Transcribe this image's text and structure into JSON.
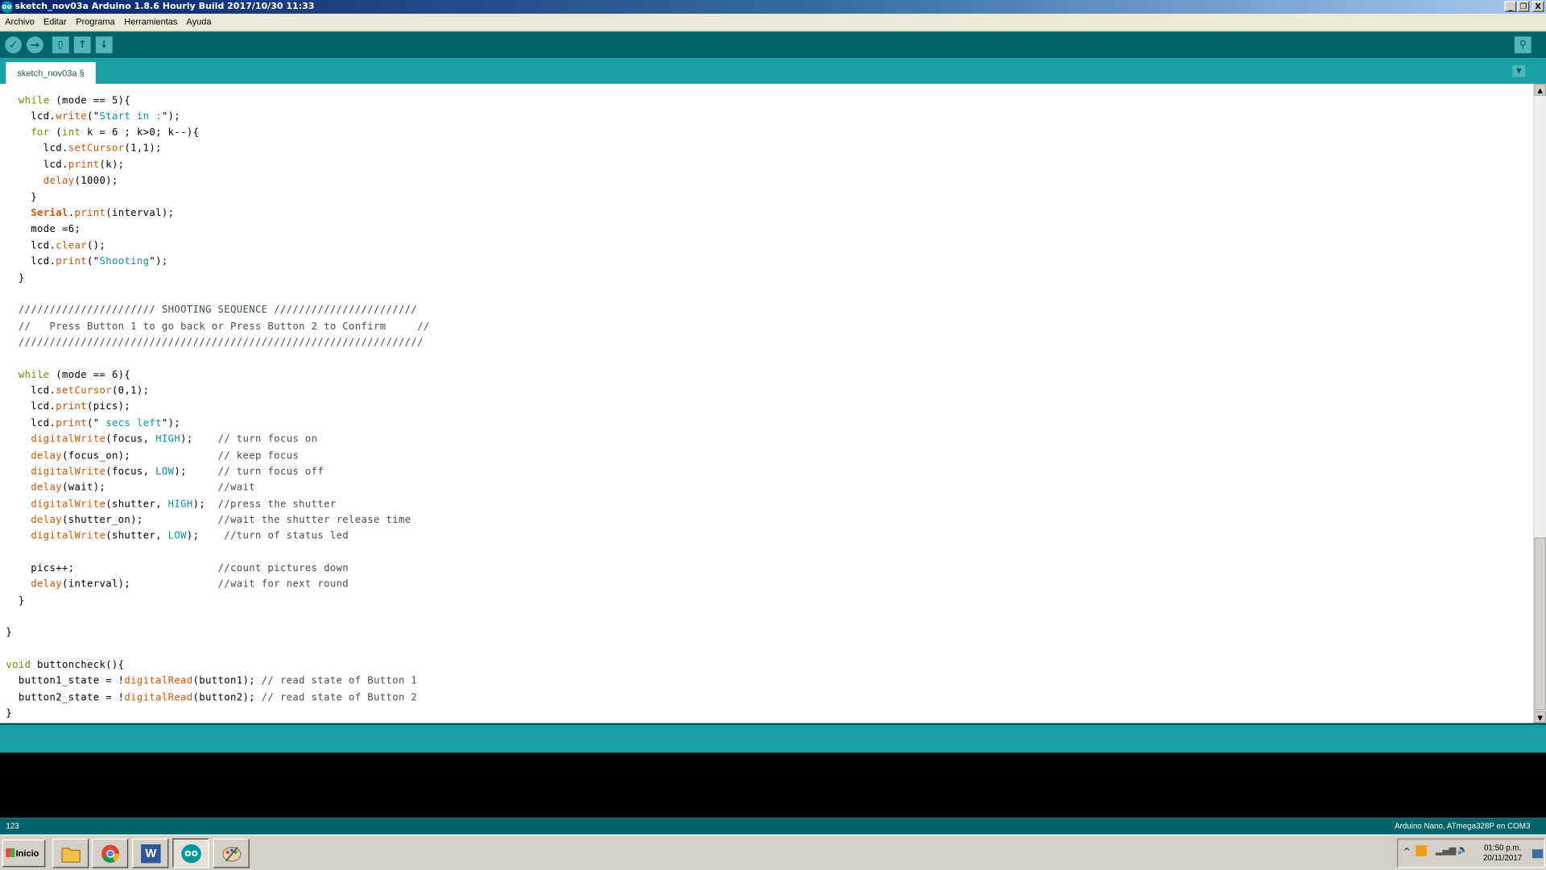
{
  "window": {
    "title": "sketch_nov03a Arduino 1.8.6 Hourly Build 2017/10/30 11:33",
    "controls": {
      "minimize": "_",
      "maximize": "❐",
      "close": "X"
    }
  },
  "menu": {
    "items": [
      "Archivo",
      "Editar",
      "Programa",
      "Herramientas",
      "Ayuda"
    ]
  },
  "toolbar": {
    "verify_icon": "✓",
    "upload_icon": "→",
    "new_icon": "▯",
    "open_icon": "↑",
    "save_icon": "↓",
    "serial_monitor_icon": "⚲"
  },
  "tabs": {
    "active": "sketch_nov03a §",
    "menu_icon": "▼"
  },
  "editor": {
    "lines": [
      "  while (mode == 5){",
      "    lcd.write(\"Start in :\");",
      "    for (int k = 6 ; k>0; k--){",
      "      lcd.setCursor(1,1);",
      "      lcd.print(k);",
      "      delay(1000);",
      "    }",
      "    Serial.print(interval);",
      "    mode =6;",
      "    lcd.clear();",
      "    lcd.print(\"Shooting\");",
      "  }",
      "",
      "  ////////////////////// SHOOTING SEQUENCE ///////////////////////",
      "  //   Press Button 1 to go back or Press Button 2 to Confirm     //",
      "  /////////////////////////////////////////////////////////////////",
      "",
      "  while (mode == 6){",
      "    lcd.setCursor(0,1);",
      "    lcd.print(pics);",
      "    lcd.print(\" secs left\");",
      "    digitalWrite(focus, HIGH);    // turn focus on",
      "    delay(focus_on);              // keep focus",
      "    digitalWrite(focus, LOW);     // turn focus off",
      "    delay(wait);                  //wait",
      "    digitalWrite(shutter, HIGH);  //press the shutter",
      "    delay(shutter_on);            //wait the shutter release time",
      "    digitalWrite(shutter, LOW);    //turn of status led",
      "",
      "    pics++;                       //count pictures down",
      "    delay(interval);              //wait for next round",
      "  }",
      "",
      "}",
      "",
      "void buttoncheck(){",
      "  button1_state = !digitalRead(button1); // read state of Button 1",
      "  button2_state = !digitalRead(button2); // read state of Button 2",
      "}"
    ]
  },
  "scrollbar": {
    "up_arrow": "▲",
    "down_arrow": "▼"
  },
  "status": {
    "line_number": "123",
    "board": "Arduino Nano, ATmega328P en COM3"
  },
  "taskbar": {
    "start_label": "Inicio",
    "word_label": "W",
    "clock_time": "01:50 p.m.",
    "clock_date": "20/11/2017"
  },
  "colors": {
    "keyword": "#728e00",
    "function": "#d35400",
    "constant": "#00979c",
    "comment": "#434f54",
    "toolbar_bg": "#006468",
    "tabbar_bg": "#17a1a5"
  }
}
